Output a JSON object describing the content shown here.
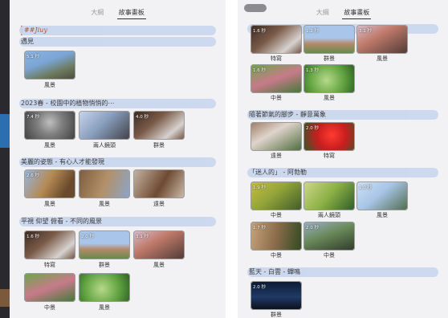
{
  "tabs": [
    "大綱",
    "故事畫板"
  ],
  "left": {
    "handwritten_title": "##Jiuy",
    "sections": [
      {
        "title": "遇見",
        "items": [
          {
            "dur": "5.1 秒",
            "label": "風景",
            "icon": "sky-thumbnail"
          }
        ]
      },
      {
        "title": "2023春 - 校園中的植物悄悄的⋯",
        "items": [
          {
            "dur": "7.4 秒",
            "label": "風景",
            "icon": "tree-thumbnail"
          },
          {
            "dur": "",
            "label": "兩人鏡頭",
            "icon": "branch-thumbnail"
          },
          {
            "dur": "4.0 秒",
            "label": "群景",
            "icon": "leaf-thumbnail"
          }
        ]
      },
      {
        "title": "美麗的姿態 - 有心人才能發現",
        "items": [
          {
            "dur": "2.6 秒",
            "label": "風景",
            "icon": "trunk-thumbnail"
          },
          {
            "dur": "",
            "label": "風景",
            "icon": "bark-thumbnail"
          },
          {
            "dur": "",
            "label": "遠景",
            "icon": "seed-thumbnail"
          }
        ]
      },
      {
        "title": "平視 仰望 俯看 - 不同的風景",
        "items": [
          {
            "dur": "1.6 秒",
            "label": "特寫",
            "icon": "leaf-closeup-thumbnail"
          },
          {
            "dur": "2.0 秒",
            "label": "群景",
            "icon": "field-thumbnail"
          },
          {
            "dur": "3.1 秒",
            "label": "風景",
            "icon": "pink-leaf-thumbnail"
          },
          {
            "dur": "",
            "label": "中景",
            "icon": "green-pink-thumbnail"
          },
          {
            "dur": "",
            "label": "風景",
            "icon": "green-leaf-thumbnail"
          }
        ]
      }
    ]
  },
  "right": {
    "sections": [
      {
        "title": "",
        "items": [
          {
            "dur": "1.6 秒",
            "label": "特寫",
            "icon": "leaf-closeup-thumbnail"
          },
          {
            "dur": "1.2 秒",
            "label": "群景",
            "icon": "field-thumbnail"
          },
          {
            "dur": "3.1 秒",
            "label": "風景",
            "icon": "pink-leaf-thumbnail"
          },
          {
            "dur": "1.6 秒",
            "label": "中景",
            "icon": "green-pink-thumbnail"
          },
          {
            "dur": "1.3 秒",
            "label": "風景",
            "icon": "green-leaf-thumbnail"
          }
        ]
      },
      {
        "title": "隨著節氣的腳步 - 靜意萬象",
        "items": [
          {
            "dur": "",
            "label": "遠景",
            "icon": "palm-thumbnail"
          },
          {
            "dur": "2.0 秒",
            "label": "特寫",
            "icon": "red-flower-thumbnail"
          }
        ]
      },
      {
        "title": "「迷人的」 - 阿勃勒",
        "items": [
          {
            "dur": "1.9 秒",
            "label": "中景",
            "icon": "yellow-tree-thumbnail"
          },
          {
            "dur": "",
            "label": "兩人鏡頭",
            "icon": "yellow-green-thumbnail"
          },
          {
            "dur": "1.0 秒",
            "label": "風景",
            "icon": "blue-tree-thumbnail"
          },
          {
            "dur": "1.7 秒",
            "label": "中景",
            "icon": "path-thumbnail"
          },
          {
            "dur": "2.0 秒",
            "label": "中景",
            "icon": "shade-thumbnail"
          }
        ]
      },
      {
        "title": "藍天 - 白雲 - 蟬鳴",
        "items": [
          {
            "dur": "2.0 秒",
            "label": "群景",
            "icon": "night-thumbnail"
          }
        ]
      }
    ]
  }
}
